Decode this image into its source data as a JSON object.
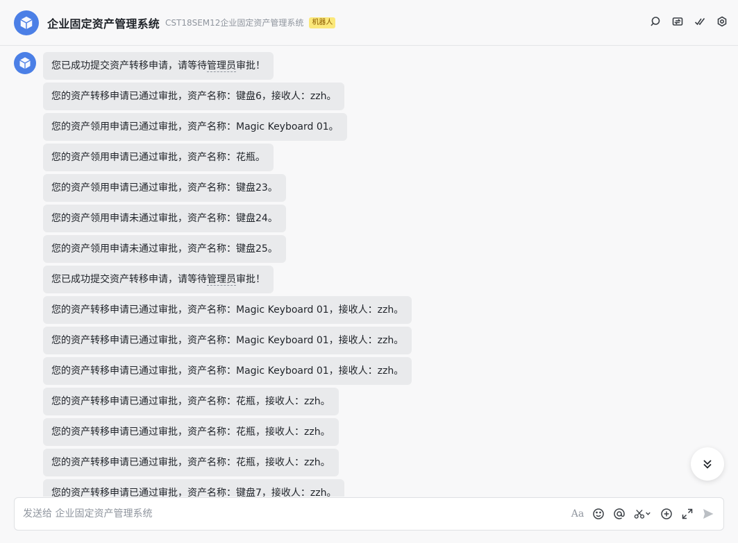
{
  "header": {
    "title": "企业固定资产管理系统",
    "subtitle": "CST18SEM12企业固定资产管理系统",
    "badge": "机器人"
  },
  "messages": [
    {
      "pre": "您已成功提交资产转移申请，请等待",
      "mark": "管理员",
      "post": "审批！"
    },
    {
      "text": "您的资产转移申请已通过审批，资产名称：键盘6，接收人：zzh。"
    },
    {
      "text": "您的资产领用申请已通过审批，资产名称：Magic Keyboard 01。"
    },
    {
      "text": "您的资产领用申请已通过审批，资产名称：花瓶。"
    },
    {
      "text": "您的资产领用申请已通过审批，资产名称：键盘23。"
    },
    {
      "text": "您的资产领用申请未通过审批，资产名称：键盘24。"
    },
    {
      "text": "您的资产领用申请未通过审批，资产名称：键盘25。"
    },
    {
      "pre": "您已成功提交资产转移申请，请等待",
      "mark": "管理员",
      "post": "审批！"
    },
    {
      "text": "您的资产转移申请已通过审批，资产名称：Magic Keyboard 01，接收人：zzh。"
    },
    {
      "text": "您的资产转移申请已通过审批，资产名称：Magic Keyboard 01，接收人：zzh。"
    },
    {
      "text": "您的资产转移申请已通过审批，资产名称：Magic Keyboard 01，接收人：zzh。"
    },
    {
      "text": "您的资产转移申请已通过审批，资产名称：花瓶，接收人：zzh。"
    },
    {
      "text": "您的资产转移申请已通过审批，资产名称：花瓶，接收人：zzh。"
    },
    {
      "text": "您的资产转移申请已通过审批，资产名称：花瓶，接收人：zzh。"
    },
    {
      "text": "您的资产转移申请已通过审批，资产名称：键盘7，接收人：zzh。"
    }
  ],
  "composer": {
    "placeholder": "发送给 企业固定资产管理系统",
    "format_glyph": "Aa"
  },
  "icons": {
    "header": [
      "search-icon",
      "transfer-icon",
      "check-icon",
      "settings-icon"
    ],
    "composer": [
      "text-format-icon",
      "emoji-icon",
      "mention-icon",
      "scissors-icon",
      "add-icon",
      "expand-icon",
      "send-icon"
    ],
    "scroll": "double-chevron-down-icon"
  },
  "colors": {
    "avatar": "#4b7fe6",
    "bubble": "#e9eaec",
    "badge": "#fbe87a"
  }
}
